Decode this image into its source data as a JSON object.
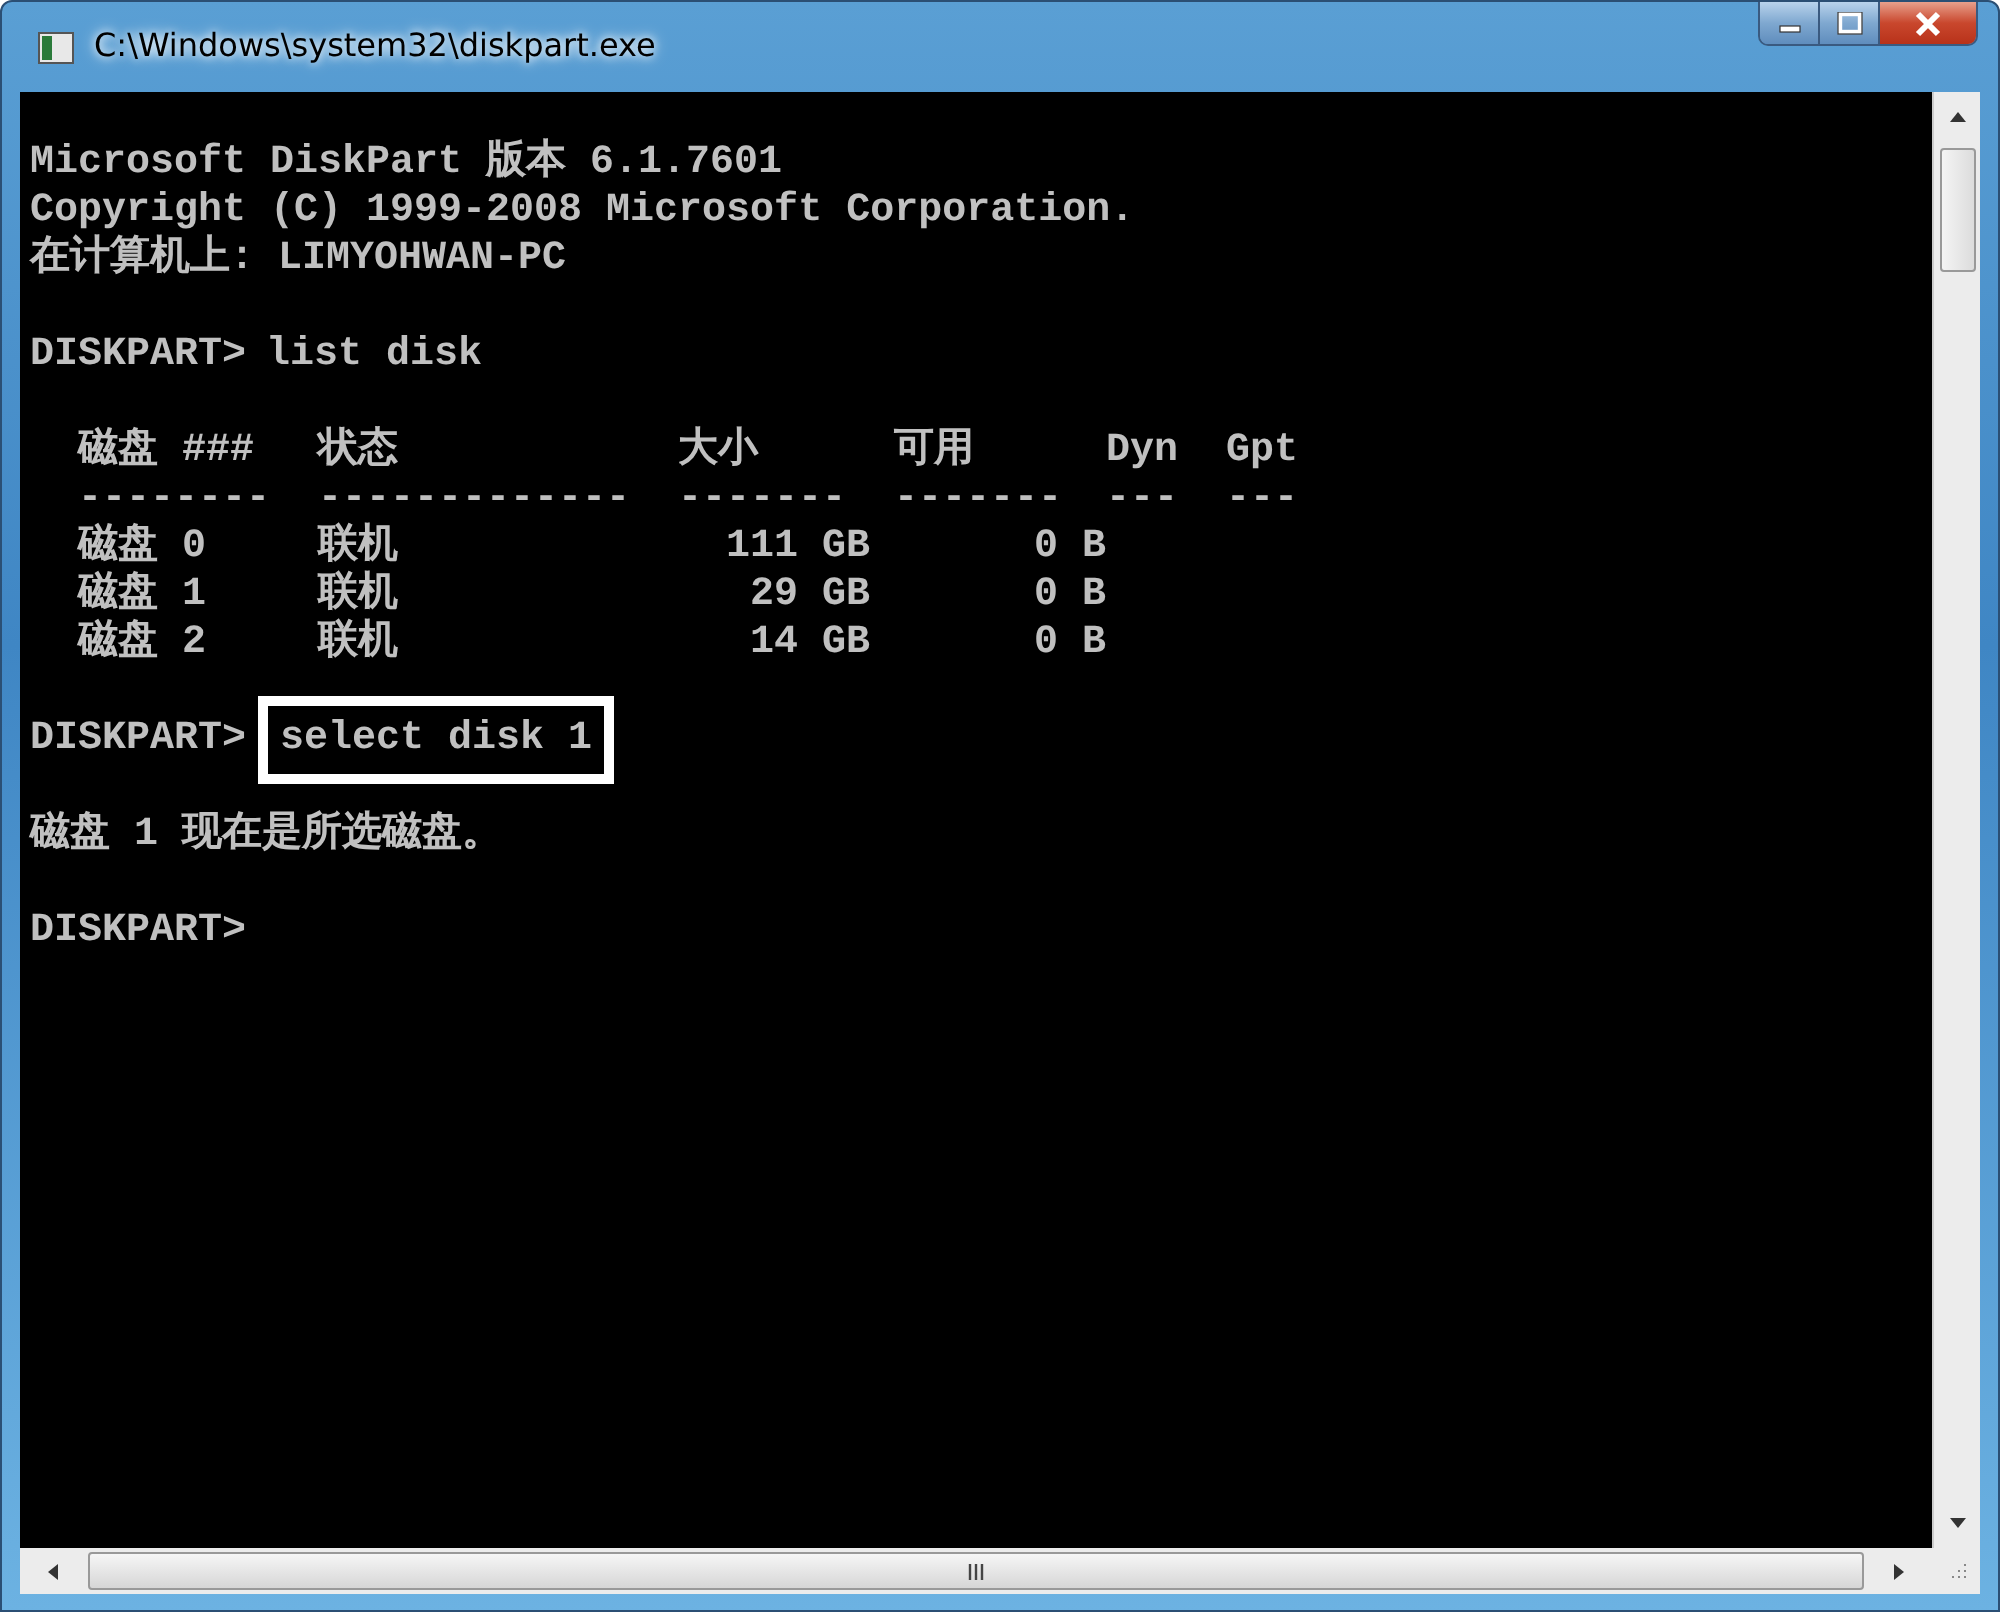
{
  "window": {
    "title": "C:\\Windows\\system32\\diskpart.exe"
  },
  "console": {
    "header_lines": [
      "Microsoft DiskPart 版本 6.1.7601",
      "Copyright (C) 1999-2008 Microsoft Corporation.",
      "在计算机上: LIMYOHWAN-PC"
    ],
    "command_1": {
      "prompt": "DISKPART>",
      "command": "list disk",
      "highlighted": false
    },
    "disk_table": {
      "columns": [
        {
          "label": "磁盘 ###",
          "rule": "--------"
        },
        {
          "label": "状态",
          "rule": "-------------"
        },
        {
          "label": "大小",
          "rule": "-------"
        },
        {
          "label": "可用",
          "rule": "-------"
        },
        {
          "label": "Dyn",
          "rule": "---"
        },
        {
          "label": "Gpt",
          "rule": "---"
        }
      ],
      "rows": [
        [
          "磁盘 0",
          "联机",
          "111 GB",
          "0 B"
        ],
        [
          "磁盘 1",
          "联机",
          "29 GB",
          "0 B"
        ],
        [
          "磁盘 2",
          "联机",
          "14 GB",
          "0 B"
        ]
      ]
    },
    "command_2": {
      "prompt": "DISKPART>",
      "command": "select disk 1",
      "highlighted": true
    },
    "output": "磁盘 1 现在是所选磁盘。",
    "prompt": "DISKPART>"
  }
}
